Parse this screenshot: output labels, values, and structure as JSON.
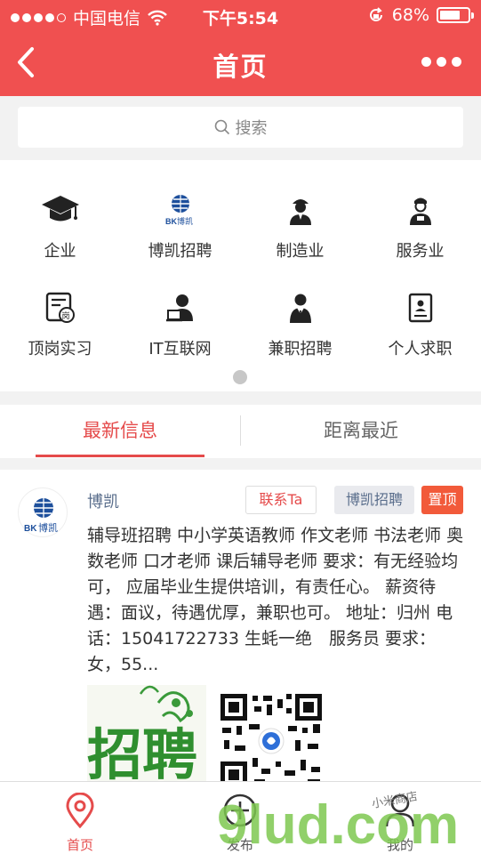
{
  "status_bar": {
    "carrier": "中国电信",
    "time": "下午5:54",
    "battery": "68%",
    "battery_level": 0.68
  },
  "nav": {
    "title": "首页"
  },
  "search": {
    "label": "搜索"
  },
  "categories": [
    {
      "label": "企业",
      "icon": "graduation-cap-icon"
    },
    {
      "label": "博凯招聘",
      "icon": "bokai-logo-icon",
      "icon_text": "博凯"
    },
    {
      "label": "制造业",
      "icon": "worker-icon"
    },
    {
      "label": "服务业",
      "icon": "service-staff-icon"
    },
    {
      "label": "顶岗实习",
      "icon": "internship-icon",
      "icon_text": "岗"
    },
    {
      "label": "IT互联网",
      "icon": "it-person-icon"
    },
    {
      "label": "兼职招聘",
      "icon": "suit-person-icon"
    },
    {
      "label": "个人求职",
      "icon": "resume-icon"
    }
  ],
  "tabs": {
    "latest": "最新信息",
    "nearest": "距离最近"
  },
  "post": {
    "author": "博凯",
    "contact_label": "联系Ta",
    "category_tag": "博凯招聘",
    "top_tag": "置顶",
    "body": "辅导班招聘 中小学英语教师 作文老师 书法老师 奥数老师 口才老师 课后辅导老师 要求：有无经验均可， 应届毕业生提供培训，有责任心。 薪资待遇：面议，待遇优厚，兼职也可。 地址：归州 电话：15041722733 生蚝一绝　服务员 要求：女，55...",
    "image1_text": "招聘",
    "avatar_text": "博凯"
  },
  "tabbar": {
    "home": "首页",
    "publish": "发布",
    "mine": "我的"
  },
  "watermark": {
    "text": "9lud.com",
    "handwriting": "小米商店"
  },
  "colors": {
    "primary": "#f05050",
    "accent": "#e54b4b",
    "top_tag": "#f25a3a",
    "link": "#5a6e8c"
  }
}
